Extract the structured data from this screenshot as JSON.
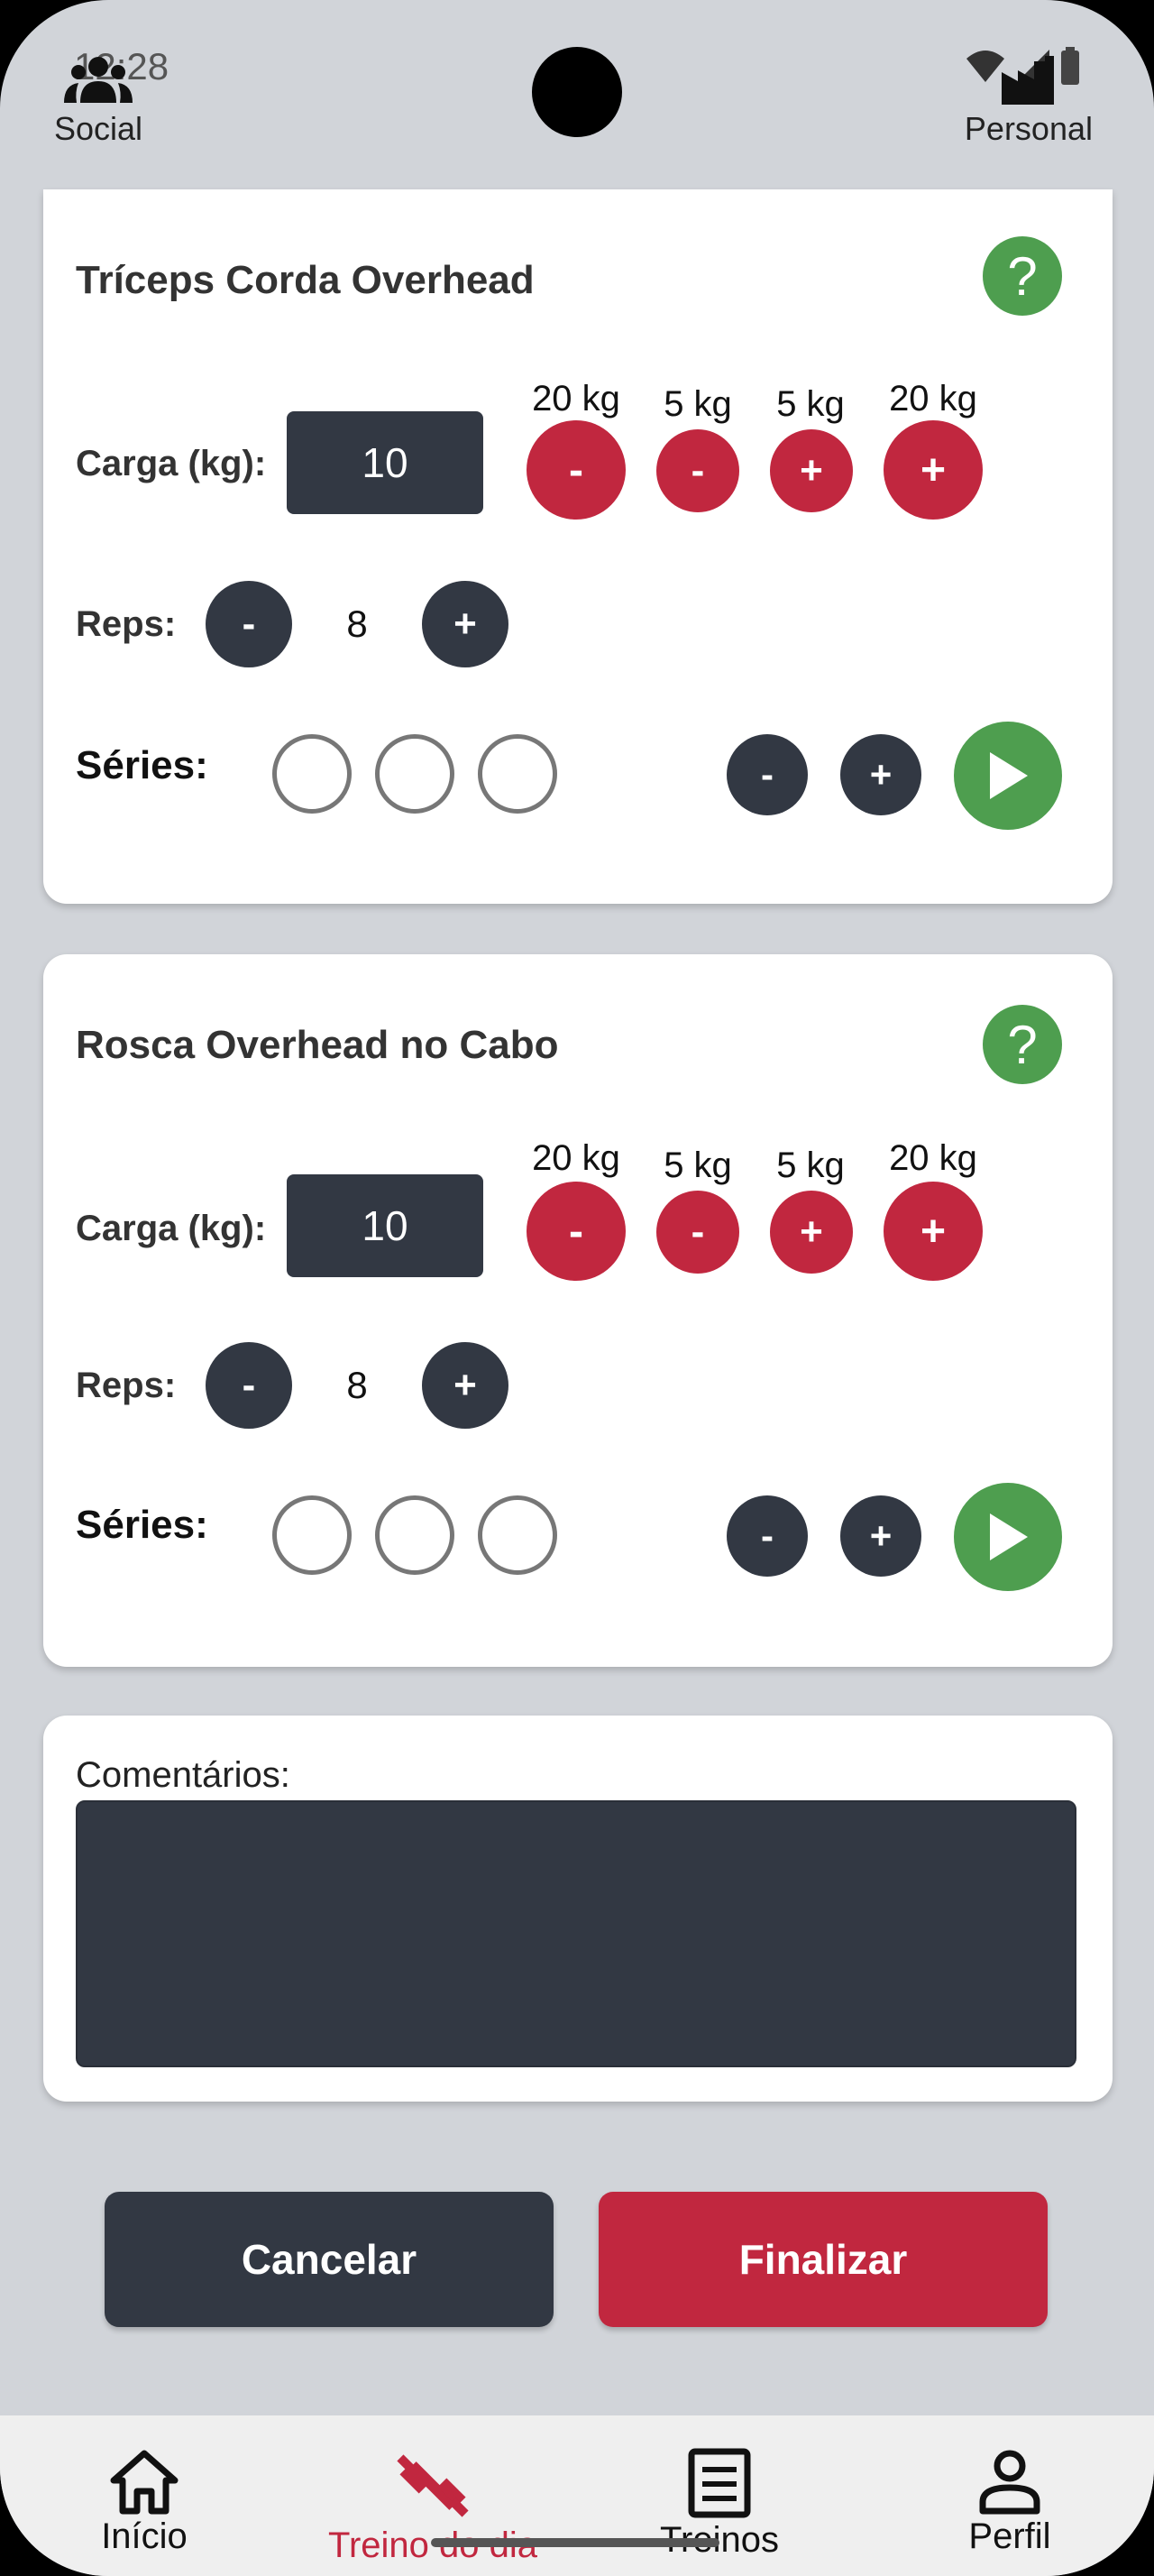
{
  "status": {
    "time": "12:28"
  },
  "top_bar": {
    "social_label": "Social",
    "personal_label": "Personal"
  },
  "exercises": [
    {
      "title": "Tríceps Corda Overhead",
      "load_label": "Carga (kg):",
      "load_value": "10",
      "step_labels": [
        "20 kg",
        "5 kg",
        "5 kg",
        "20 kg"
      ],
      "step_buttons": [
        "-",
        "-",
        "+",
        "+"
      ],
      "reps_label": "Reps:",
      "reps_value": "8",
      "reps_minus": "-",
      "reps_plus": "+",
      "series_label": "Séries:",
      "series_minus": "-",
      "series_plus": "+",
      "help": "?"
    },
    {
      "title": "Rosca Overhead no Cabo",
      "load_label": "Carga (kg):",
      "load_value": "10",
      "step_labels": [
        "20 kg",
        "5 kg",
        "5 kg",
        "20 kg"
      ],
      "step_buttons": [
        "-",
        "-",
        "+",
        "+"
      ],
      "reps_label": "Reps:",
      "reps_value": "8",
      "reps_minus": "-",
      "reps_plus": "+",
      "series_label": "Séries:",
      "series_minus": "-",
      "series_plus": "+",
      "help": "?"
    }
  ],
  "comments": {
    "label": "Comentários:",
    "value": ""
  },
  "actions": {
    "cancel": "Cancelar",
    "finish": "Finalizar"
  },
  "bottom_nav": {
    "items": [
      {
        "label": "Início",
        "icon": "home-icon"
      },
      {
        "label": "Treino do dia",
        "icon": "dumbbell-icon",
        "active": true
      },
      {
        "label": "Treinos",
        "icon": "list-icon"
      },
      {
        "label": "Perfil",
        "icon": "person-icon"
      }
    ]
  },
  "colors": {
    "accent_red": "#c1273f",
    "dark": "#323843",
    "green": "#4e9e4f",
    "background": "#d1d4d9"
  }
}
